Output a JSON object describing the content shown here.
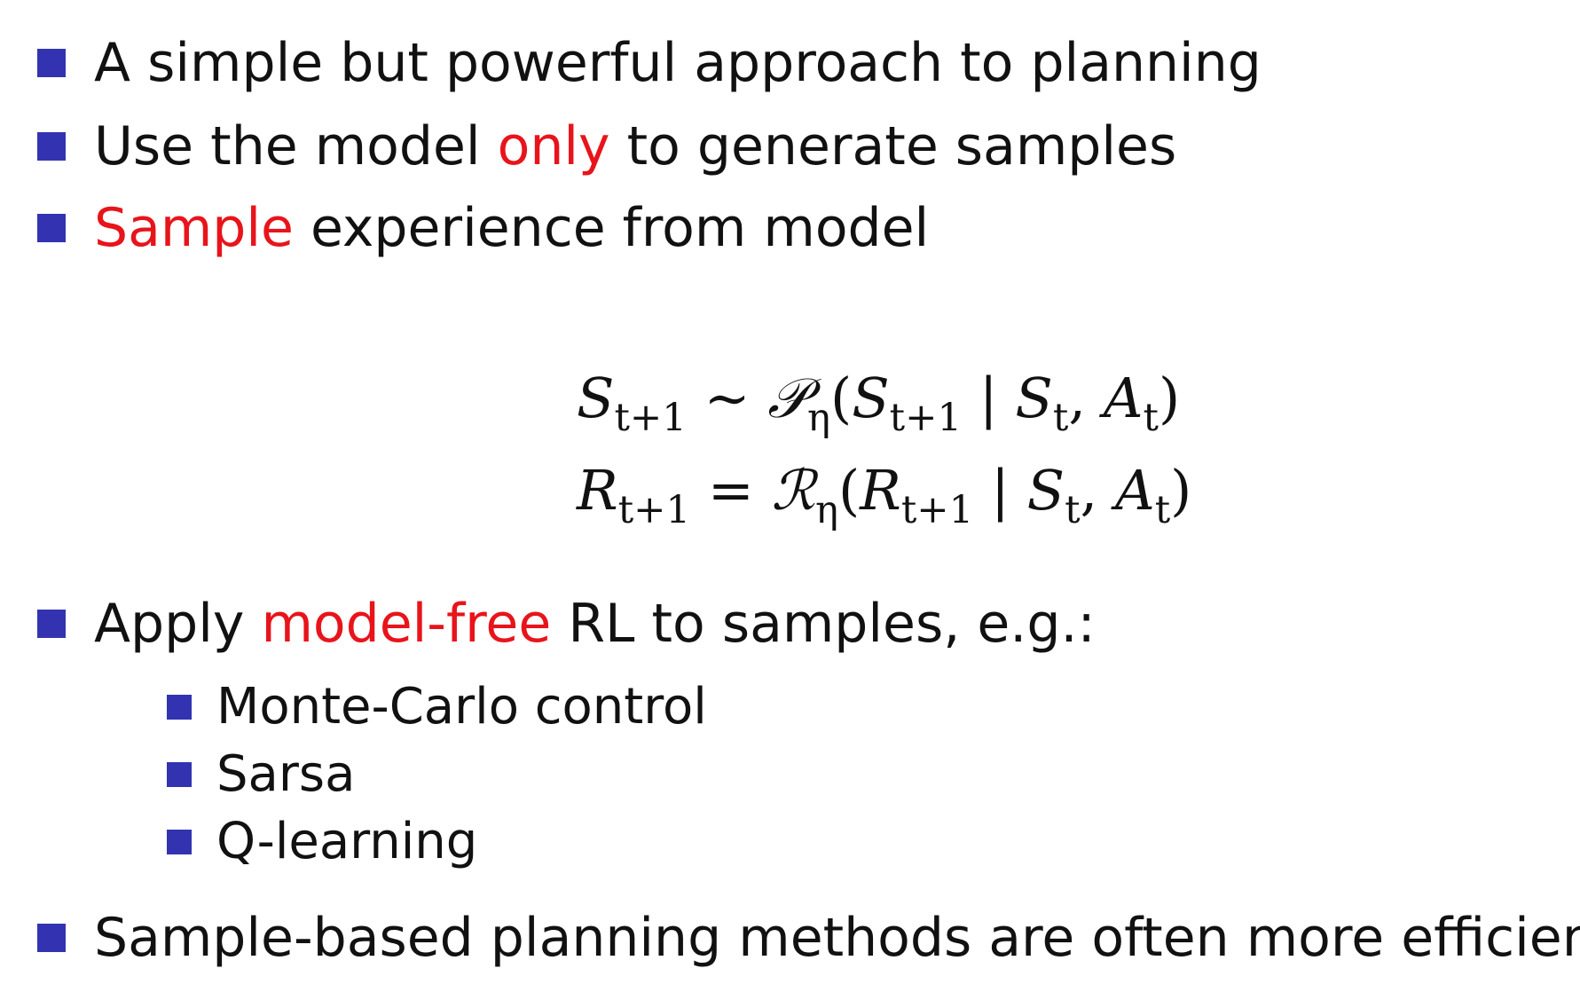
{
  "colors": {
    "bullet": "#3333b2",
    "highlight": "#e8141b",
    "text": "#111111"
  },
  "bullets_top": [
    {
      "pre": "A simple but powerful approach to planning",
      "hl": "",
      "post": ""
    },
    {
      "pre": "Use the model ",
      "hl": "only",
      "post": " to generate samples"
    },
    {
      "pre": "",
      "hl": "Sample",
      "post": " experience from model"
    }
  ],
  "equations": {
    "eq1": {
      "lhs_var": "S",
      "lhs_sub": "t+1",
      "relation": "∼",
      "func": "𝒫",
      "func_sub": "η",
      "arg_var": "S",
      "arg_sub": "t+1",
      "bar": "|",
      "c1_var": "S",
      "c1_sub": "t",
      "comma": ",",
      "c2_var": "A",
      "c2_sub": "t"
    },
    "eq2": {
      "lhs_var": "R",
      "lhs_sub": "t+1",
      "relation": "=",
      "func": "ℛ",
      "func_sub": "η",
      "arg_var": "R",
      "arg_sub": "t+1",
      "bar": "|",
      "c1_var": "S",
      "c1_sub": "t",
      "comma": ",",
      "c2_var": "A",
      "c2_sub": "t"
    }
  },
  "bullet_apply": {
    "pre": "Apply ",
    "hl": "model-free",
    "post": " RL to samples, e.g.:"
  },
  "sub_bullets": [
    "Monte-Carlo control",
    "Sarsa",
    "Q-learning"
  ],
  "bullet_last": "Sample-based planning methods are often more efficient"
}
